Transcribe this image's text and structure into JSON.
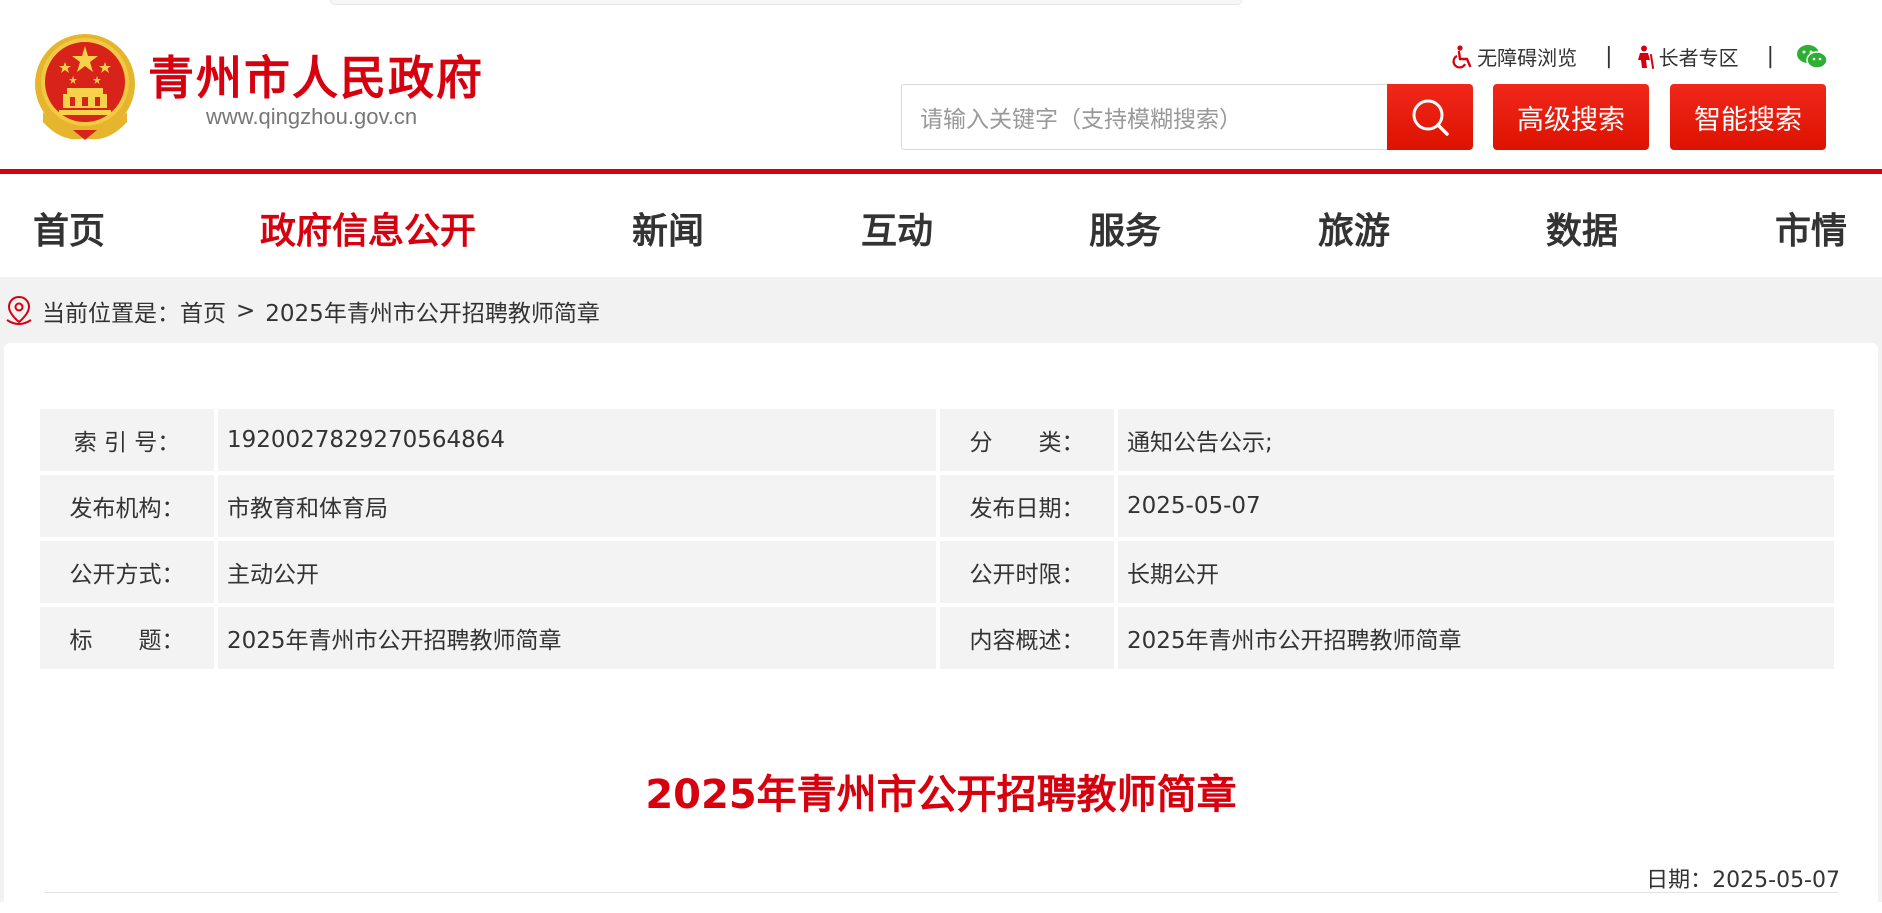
{
  "header": {
    "site_name": "青州市人民政府",
    "site_url": "www.qingzhou.gov.cn",
    "utilities": {
      "accessibility": "无障碍浏览",
      "elderly": "长者专区",
      "separator": "|"
    },
    "search": {
      "placeholder": "请输入关键字（支持模糊搜索）",
      "advanced_label": "高级搜索",
      "smart_label": "智能搜索"
    }
  },
  "nav": {
    "items": [
      {
        "label": "首页"
      },
      {
        "label": "政府信息公开"
      },
      {
        "label": "新闻"
      },
      {
        "label": "互动"
      },
      {
        "label": "服务"
      },
      {
        "label": "旅游"
      },
      {
        "label": "数据"
      },
      {
        "label": "市情"
      }
    ],
    "active_index": 1
  },
  "breadcrumb": {
    "prefix": "当前位置是：",
    "home": "首页",
    "separator": ">",
    "current": "2025年青州市公开招聘教师简章"
  },
  "meta": {
    "rows": [
      {
        "l1": "索 引 号：",
        "v1": "1920027829270564864",
        "l2": "分　　类：",
        "v2": "通知公告公示;"
      },
      {
        "l1": "发布机构：",
        "v1": "市教育和体育局",
        "l2": "发布日期：",
        "v2": "2025-05-07"
      },
      {
        "l1": "公开方式：",
        "v1": "主动公开",
        "l2": "公开时限：",
        "v2": "长期公开"
      },
      {
        "l1": "标　　题：",
        "v1": "2025年青州市公开招聘教师简章",
        "l2": "内容概述：",
        "v2": "2025年青州市公开招聘教师简章"
      }
    ]
  },
  "article": {
    "title": "2025年青州市公开招聘教师简章",
    "date_label": "日期：",
    "date": "2025-05-07"
  },
  "colors": {
    "brand_red": "#d6000f",
    "button_red": "#e81a0b",
    "page_gray": "#f2f2f2",
    "cell_gray": "#f3f3f3"
  },
  "icons": {
    "emblem": "national-emblem-icon",
    "accessibility": "wheelchair-icon",
    "elderly": "elderly-person-icon",
    "wechat": "wechat-icon",
    "search": "search-icon",
    "location": "location-pin-icon"
  }
}
